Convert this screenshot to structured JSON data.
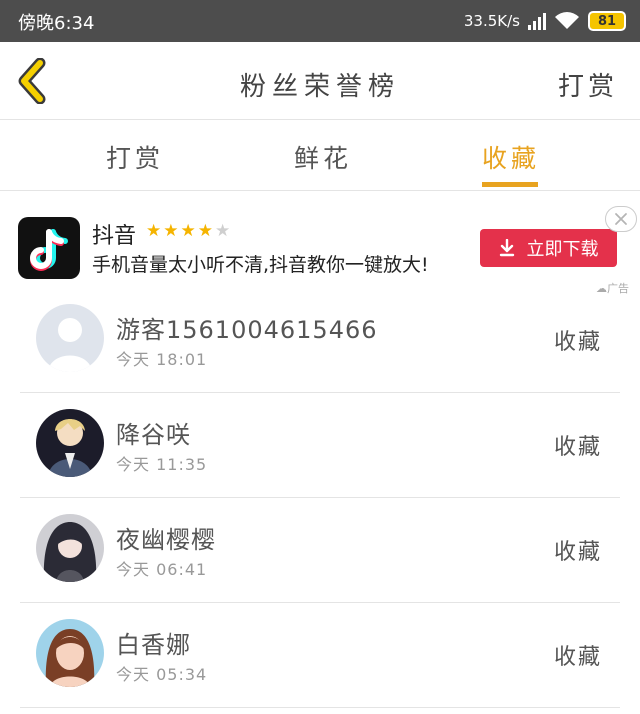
{
  "status_bar": {
    "time": "傍晚6:34",
    "network_speed": "33.5K/s",
    "battery": "81",
    "icons": [
      "signal-icon",
      "wifi-icon",
      "battery-icon"
    ]
  },
  "header": {
    "title": "粉丝荣誉榜",
    "right_link": "打赏",
    "back_icon": "chevron-left-icon"
  },
  "tabs": [
    {
      "label": "打赏",
      "active": false
    },
    {
      "label": "鲜花",
      "active": false
    },
    {
      "label": "收藏",
      "active": true
    }
  ],
  "ad": {
    "app_name": "抖音",
    "rating": 4,
    "rating_max": 5,
    "description": "手机音量太小听不清,抖音教你一键放大!",
    "button_label": "立即下载",
    "tag": "广告",
    "icons": [
      "tiktok-logo-icon",
      "download-icon",
      "close-icon",
      "cloud-icon"
    ]
  },
  "list": [
    {
      "name": "游客1561004615466",
      "time": "今天 18:01",
      "action": "收藏"
    },
    {
      "name": "降谷咲",
      "time": "今天 11:35",
      "action": "收藏"
    },
    {
      "name": "夜幽樱樱",
      "time": "今天 06:41",
      "action": "收藏"
    },
    {
      "name": "白香娜",
      "time": "今天 05:34",
      "action": "收藏"
    }
  ],
  "colors": {
    "accent": "#e8a320",
    "status_bar": "#4d4d4d",
    "ad_button": "#e4314b",
    "star": "#f5b400",
    "battery": "#f5c400"
  }
}
